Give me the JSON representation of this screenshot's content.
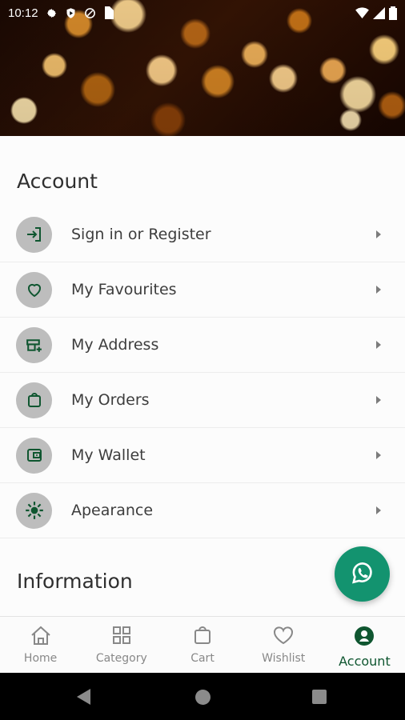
{
  "status_bar": {
    "time": "10:12",
    "icons": [
      "gear-icon",
      "shield-icon",
      "dnd-icon",
      "sim-icon",
      "wifi-icon",
      "signal-icon",
      "battery-icon"
    ]
  },
  "account": {
    "title": "Account",
    "items": [
      {
        "label": "Sign in or Register",
        "icon": "sign-in-icon"
      },
      {
        "label": "My Favourites",
        "icon": "heart-icon"
      },
      {
        "label": "My Address",
        "icon": "address-icon"
      },
      {
        "label": "My Orders",
        "icon": "bag-icon"
      },
      {
        "label": "My Wallet",
        "icon": "wallet-icon"
      },
      {
        "label": "Apearance",
        "icon": "sun-icon"
      }
    ]
  },
  "information": {
    "title": "Information"
  },
  "fab": {
    "icon": "whatsapp-icon"
  },
  "bottom_nav": {
    "items": [
      {
        "label": "Home",
        "icon": "home-icon",
        "active": false
      },
      {
        "label": "Category",
        "icon": "grid-icon",
        "active": false
      },
      {
        "label": "Cart",
        "icon": "cart-icon",
        "active": false
      },
      {
        "label": "Wishlist",
        "icon": "heart-icon",
        "active": false
      },
      {
        "label": "Account",
        "icon": "account-icon",
        "active": true
      }
    ]
  },
  "colors": {
    "primary": "#0f5630",
    "fab": "#13936f",
    "icon_bg": "#bdbdbd"
  }
}
